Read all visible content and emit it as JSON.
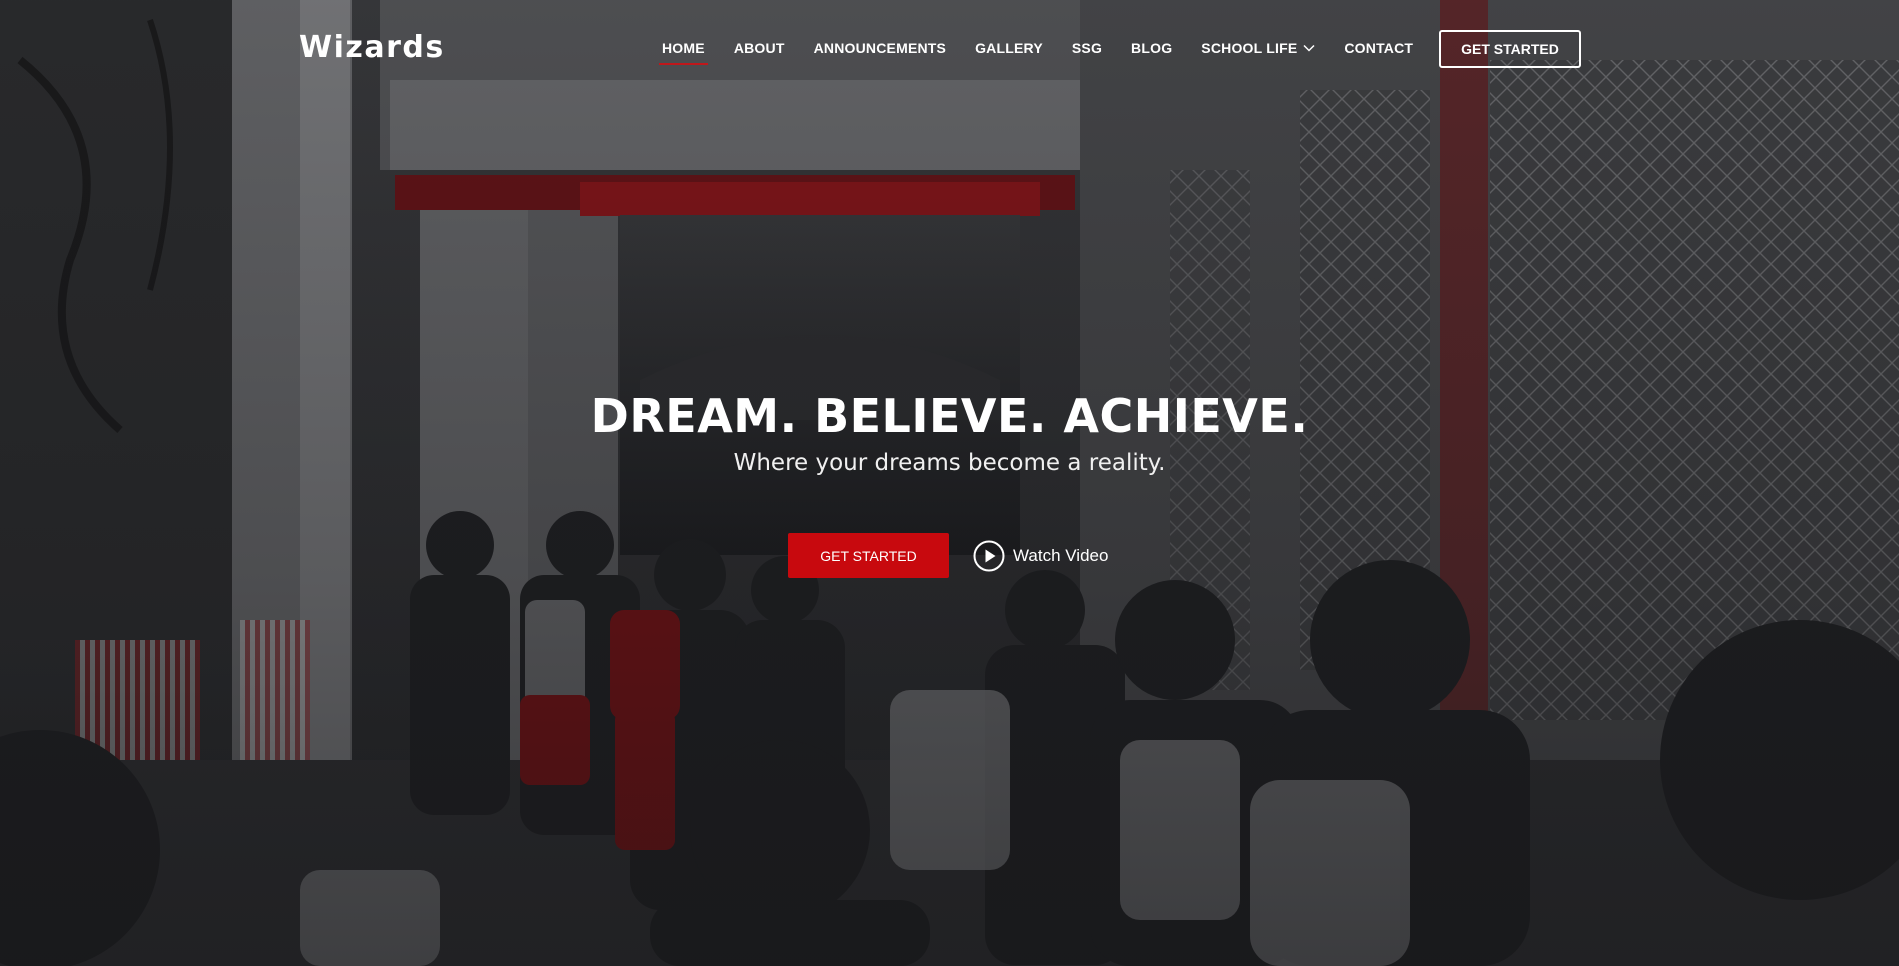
{
  "brand": {
    "name": "Wizards"
  },
  "nav": {
    "items": [
      {
        "label": "HOME",
        "active": true
      },
      {
        "label": "ABOUT"
      },
      {
        "label": "ANNOUNCEMENTS"
      },
      {
        "label": "GALLERY"
      },
      {
        "label": "SSG"
      },
      {
        "label": "BLOG"
      },
      {
        "label": "SCHOOL LIFE",
        "has_dropdown": true
      },
      {
        "label": "CONTACT"
      }
    ],
    "cta_label": "GET STARTED"
  },
  "hero": {
    "title": "DREAM. BELIEVE. ACHIEVE.",
    "subtitle": "Where your dreams become a reality.",
    "primary_button": "GET STARTED",
    "video_link": "Watch Video"
  },
  "colors": {
    "accent": "#c8090e",
    "text": "#ffffff",
    "overlay": "#1d1e21"
  },
  "icons": {
    "dropdown": "chevron-down-icon",
    "video": "play-circle-icon"
  }
}
